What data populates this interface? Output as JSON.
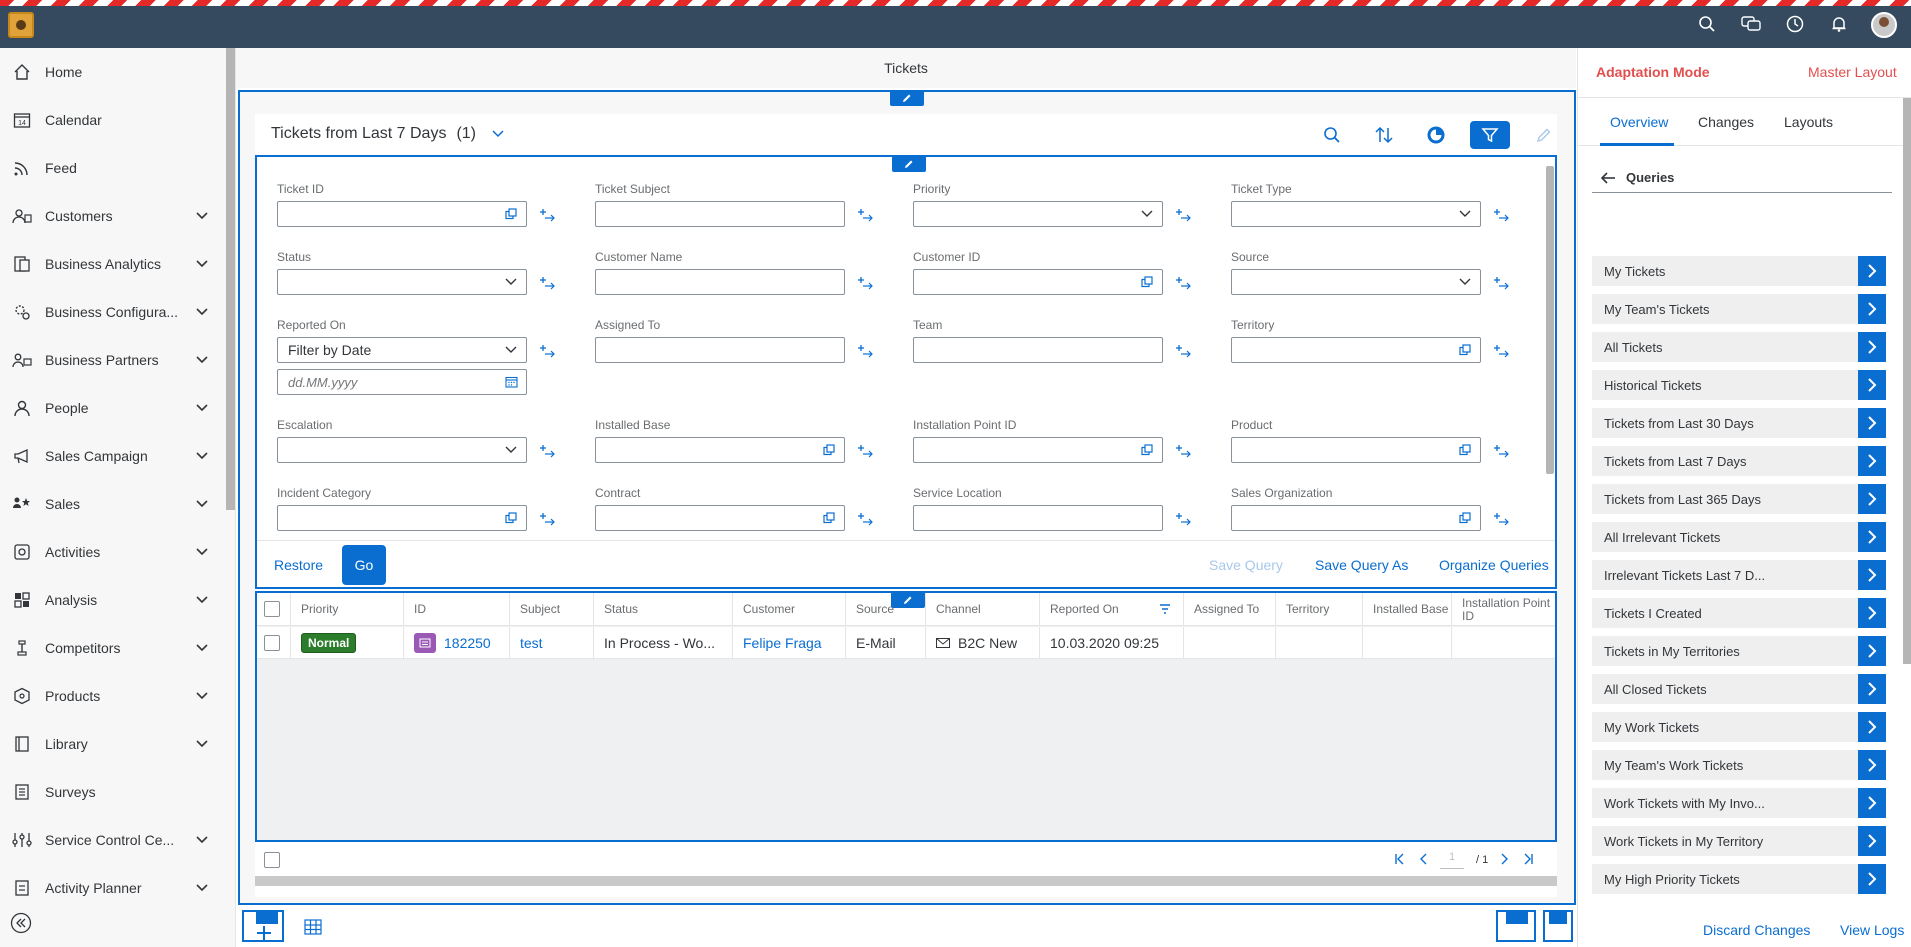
{
  "header": {
    "icons": [
      "search-icon",
      "chat-icon",
      "clock-icon",
      "bell-icon"
    ]
  },
  "sidebar": {
    "items": [
      {
        "label": "Home",
        "icon": "home-icon",
        "expandable": false
      },
      {
        "label": "Calendar",
        "icon": "calendar-icon",
        "expandable": false
      },
      {
        "label": "Feed",
        "icon": "feed-icon",
        "expandable": false
      },
      {
        "label": "Customers",
        "icon": "customers-icon",
        "expandable": true
      },
      {
        "label": "Business Analytics",
        "icon": "analytics-icon",
        "expandable": true
      },
      {
        "label": "Business Configura...",
        "icon": "configuration-icon",
        "expandable": true
      },
      {
        "label": "Business Partners",
        "icon": "partners-icon",
        "expandable": true
      },
      {
        "label": "People",
        "icon": "person-icon",
        "expandable": true
      },
      {
        "label": "Sales Campaign",
        "icon": "megaphone-icon",
        "expandable": true
      },
      {
        "label": "Sales",
        "icon": "sales-icon",
        "expandable": true
      },
      {
        "label": "Activities",
        "icon": "activities-icon",
        "expandable": true
      },
      {
        "label": "Analysis",
        "icon": "analysis-icon",
        "expandable": true
      },
      {
        "label": "Competitors",
        "icon": "competitors-icon",
        "expandable": true
      },
      {
        "label": "Products",
        "icon": "product-icon",
        "expandable": true
      },
      {
        "label": "Library",
        "icon": "library-icon",
        "expandable": true
      },
      {
        "label": "Surveys",
        "icon": "survey-icon",
        "expandable": false
      },
      {
        "label": "Service Control Ce...",
        "icon": "service-control-icon",
        "expandable": true
      },
      {
        "label": "Activity Planner",
        "icon": "planner-icon",
        "expandable": true
      }
    ],
    "calendar_day": "14"
  },
  "page": {
    "title": "Tickets"
  },
  "list": {
    "title": "Tickets from Last 7 Days",
    "count": "(1)"
  },
  "filters": {
    "ticket_id": {
      "label": "Ticket ID",
      "value": ""
    },
    "ticket_subject": {
      "label": "Ticket Subject",
      "value": ""
    },
    "priority": {
      "label": "Priority",
      "value": ""
    },
    "ticket_type": {
      "label": "Ticket Type",
      "value": ""
    },
    "status": {
      "label": "Status",
      "value": ""
    },
    "customer_name": {
      "label": "Customer Name",
      "value": ""
    },
    "customer_id": {
      "label": "Customer ID",
      "value": ""
    },
    "source": {
      "label": "Source",
      "value": ""
    },
    "reported_on": {
      "label": "Reported On",
      "value": "Filter by Date",
      "date_placeholder": "dd.MM.yyyy"
    },
    "assigned_to": {
      "label": "Assigned To",
      "value": ""
    },
    "team": {
      "label": "Team",
      "value": ""
    },
    "territory": {
      "label": "Territory",
      "value": ""
    },
    "escalation": {
      "label": "Escalation",
      "value": ""
    },
    "installed_base": {
      "label": "Installed Base",
      "value": ""
    },
    "installation_point_id": {
      "label": "Installation Point ID",
      "value": ""
    },
    "product": {
      "label": "Product",
      "value": ""
    },
    "incident_category": {
      "label": "Incident Category",
      "value": ""
    },
    "contract": {
      "label": "Contract",
      "value": ""
    },
    "service_location": {
      "label": "Service Location",
      "value": ""
    },
    "sales_organization": {
      "label": "Sales Organization",
      "value": ""
    }
  },
  "actions": {
    "restore": "Restore",
    "go": "Go",
    "save_query": "Save Query",
    "save_query_as": "Save Query As",
    "organize_queries": "Organize Queries"
  },
  "table": {
    "columns": [
      "Priority",
      "ID",
      "Subject",
      "Status",
      "Customer",
      "Source",
      "Channel",
      "Reported On",
      "Assigned To",
      "Territory",
      "Installed Base",
      "Installation Point ID"
    ],
    "rows": [
      {
        "priority": "Normal",
        "id": "182250",
        "subject": "test",
        "status": "In Process - Wo...",
        "customer": "Felipe Fraga",
        "source": "E-Mail",
        "channel": "B2C New",
        "reported_on": "10.03.2020 09:25",
        "assigned_to": "",
        "territory": "",
        "installed_base": "",
        "installation_point_id": ""
      }
    ],
    "priority_color": "#2b7d2b"
  },
  "pagination": {
    "current": "1",
    "total": "/ 1"
  },
  "right_panel": {
    "mode": "Adaptation Mode",
    "layout": "Master Layout",
    "tabs": [
      "Overview",
      "Changes",
      "Layouts"
    ],
    "active_tab": "Overview",
    "section_title": "Queries",
    "queries": [
      "My Tickets",
      "My Team's Tickets",
      "All Tickets",
      "Historical Tickets",
      "Tickets from Last 30 Days",
      "Tickets from Last 7 Days",
      "Tickets from Last 365 Days",
      "All Irrelevant Tickets",
      "Irrelevant Tickets Last 7 D...",
      "Tickets I Created",
      "Tickets in My Territories",
      "All Closed Tickets",
      "My Work Tickets",
      "My Team's Work Tickets",
      "Work Tickets with My Invo...",
      "Work Tickets in My Territory",
      "My High Priority Tickets"
    ],
    "discard_changes": "Discard Changes",
    "view_logs": "View Logs"
  },
  "colors": {
    "shell": "#354a5f",
    "accent": "#0a6ed1",
    "adaptation": "#e34e4e"
  }
}
